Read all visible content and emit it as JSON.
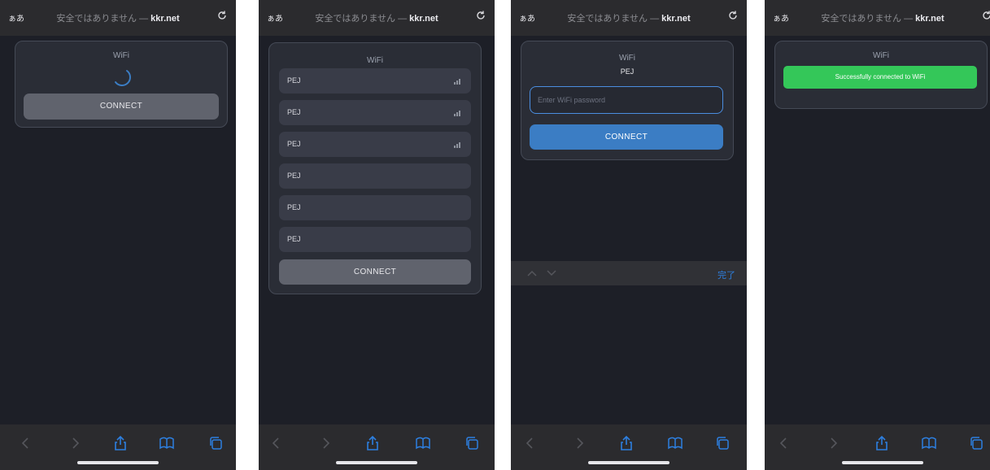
{
  "browser": {
    "text_size_label": "ぁあ",
    "url_prefix": "安全ではありません — ",
    "url_domain": "kkr.net"
  },
  "card": {
    "title": "WiFi"
  },
  "connect_label": "CONNECT",
  "networks": [
    "PEJ",
    "PEJ",
    "PEJ",
    "PEJ",
    "PEJ",
    "PEJ"
  ],
  "selected_network": "PEJ",
  "password": {
    "placeholder": "Enter WiFi password"
  },
  "keyboard_bar": {
    "done_label": "完了"
  },
  "success_message": "Successfully connected to WiFi",
  "colors": {
    "primary": "#3b7dc4",
    "success": "#34c759",
    "link": "#2d7fe0"
  }
}
